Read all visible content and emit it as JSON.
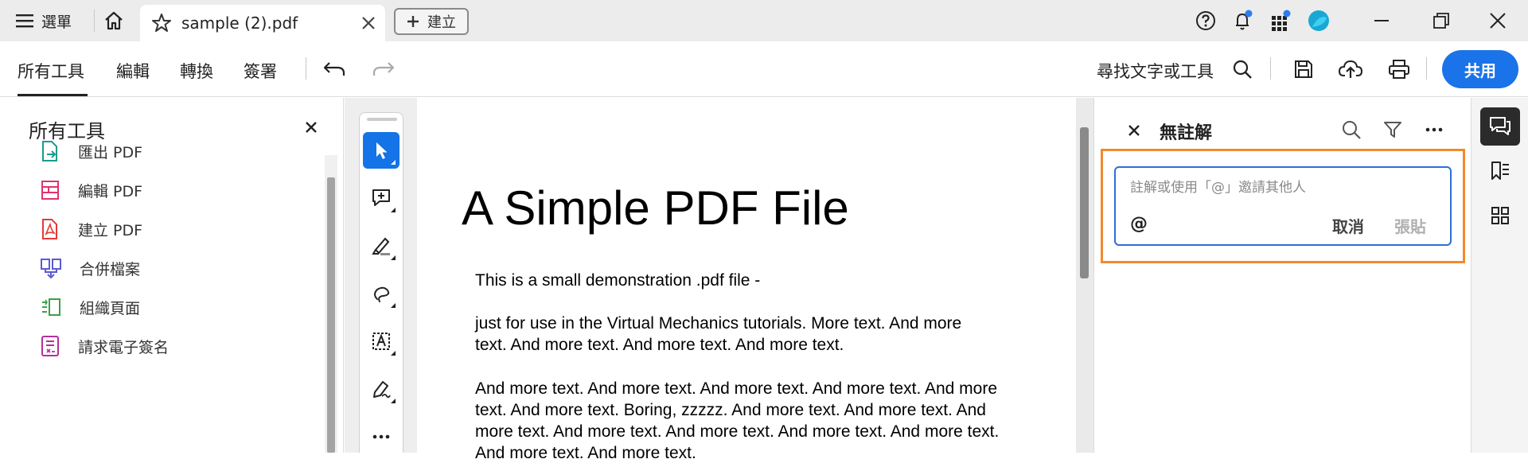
{
  "titlebar": {
    "menu_label": "選單",
    "tab_title": "sample (2).pdf",
    "create_label": "建立"
  },
  "toolbar": {
    "tabs": [
      "所有工具",
      "編輯",
      "轉換",
      "簽署"
    ],
    "active_tab": "所有工具",
    "search_label": "尋找文字或工具",
    "share_label": "共用"
  },
  "left_panel": {
    "title": "所有工具",
    "items": [
      {
        "label": "匯出 PDF",
        "icon": "export-pdf-icon",
        "color": "#1a9c8f"
      },
      {
        "label": "編輯 PDF",
        "icon": "edit-pdf-icon",
        "color": "#e0336c"
      },
      {
        "label": "建立 PDF",
        "icon": "create-pdf-icon",
        "color": "#e23a3a"
      },
      {
        "label": "合併檔案",
        "icon": "combine-files-icon",
        "color": "#5a5ad6"
      },
      {
        "label": "組織頁面",
        "icon": "organize-pages-icon",
        "color": "#3aa14a"
      },
      {
        "label": "請求電子簽名",
        "icon": "request-esign-icon",
        "color": "#b4309a"
      }
    ]
  },
  "document": {
    "title": "A Simple PDF File",
    "lines": [
      "This is a small demonstration .pdf file -",
      "just for use in the Virtual Mechanics tutorials. More text. And more",
      "text. And more text. And more text. And more text.",
      "And more text. And more text. And more text. And more text. And more",
      "text. And more text. Boring, zzzzz. And more text. And more text. And",
      "more text. And more text. And more text. And more text. And more text.",
      "And more text. And more text."
    ]
  },
  "comments": {
    "title": "無註解",
    "placeholder": "註解或使用「@」邀請其他人",
    "mention_symbol": "@",
    "cancel_label": "取消",
    "paste_label": "張貼"
  },
  "colors": {
    "accent": "#1473e6",
    "share_button": "#1a73e8",
    "focus_frame": "#f08a2e",
    "notification_dot": "#2a7df0"
  }
}
